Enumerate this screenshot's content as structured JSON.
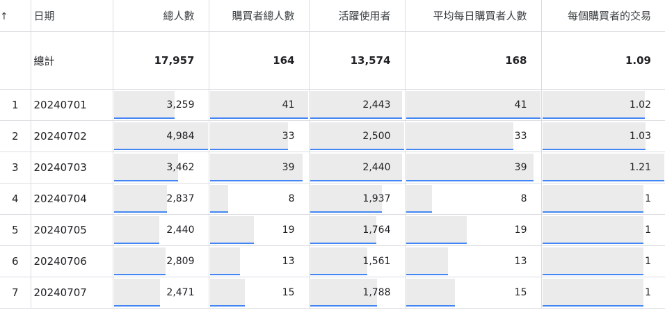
{
  "headers": {
    "sort_icon": "↑",
    "date": "日期",
    "total_users": "總人數",
    "total_purchasers": "購買者總人數",
    "active_users": "活躍使用者",
    "avg_daily_purchasers": "平均每日購買者人數",
    "transactions_per_purchaser": "每個購買者的交易"
  },
  "totals": {
    "label": "總計",
    "total_users": "17,957",
    "total_purchasers": "164",
    "active_users": "13,574",
    "avg_daily_purchasers": "168",
    "transactions_per_purchaser": "1.09"
  },
  "rows": [
    {
      "idx": "1",
      "date": "20240701",
      "total_users": "3,259",
      "total_purchasers": "41",
      "active_users": "2,443",
      "avg_daily_purchasers": "41",
      "transactions_per_purchaser": "1.02"
    },
    {
      "idx": "2",
      "date": "20240702",
      "total_users": "4,984",
      "total_purchasers": "33",
      "active_users": "2,500",
      "avg_daily_purchasers": "33",
      "transactions_per_purchaser": "1.03"
    },
    {
      "idx": "3",
      "date": "20240703",
      "total_users": "3,462",
      "total_purchasers": "39",
      "active_users": "2,440",
      "avg_daily_purchasers": "39",
      "transactions_per_purchaser": "1.21"
    },
    {
      "idx": "4",
      "date": "20240704",
      "total_users": "2,837",
      "total_purchasers": "8",
      "active_users": "1,937",
      "avg_daily_purchasers": "8",
      "transactions_per_purchaser": "1"
    },
    {
      "idx": "5",
      "date": "20240705",
      "total_users": "2,440",
      "total_purchasers": "19",
      "active_users": "1,764",
      "avg_daily_purchasers": "19",
      "transactions_per_purchaser": "1"
    },
    {
      "idx": "6",
      "date": "20240706",
      "total_users": "2,809",
      "total_purchasers": "13",
      "active_users": "1,561",
      "avg_daily_purchasers": "13",
      "transactions_per_purchaser": "1"
    },
    {
      "idx": "7",
      "date": "20240707",
      "total_users": "2,471",
      "total_purchasers": "15",
      "active_users": "1,788",
      "avg_daily_purchasers": "15",
      "transactions_per_purchaser": "1"
    }
  ],
  "bar_fill": {
    "total_users": [
      0.65,
      1.0,
      0.69,
      0.57,
      0.49,
      0.56,
      0.5
    ],
    "total_purchasers": [
      1.0,
      0.8,
      0.95,
      0.2,
      0.46,
      0.32,
      0.37
    ],
    "active_users": [
      0.98,
      1.0,
      0.98,
      0.77,
      0.71,
      0.62,
      0.72
    ],
    "avg_daily_purchasers": [
      1.0,
      0.8,
      0.95,
      0.2,
      0.46,
      0.32,
      0.37
    ],
    "transactions_per_purchaser": [
      0.84,
      0.85,
      1.0,
      0.83,
      0.83,
      0.83,
      0.83
    ]
  },
  "colors": {
    "bar": "#ebebeb",
    "bar_accent": "#4285f4",
    "grid": "#dadce0"
  }
}
